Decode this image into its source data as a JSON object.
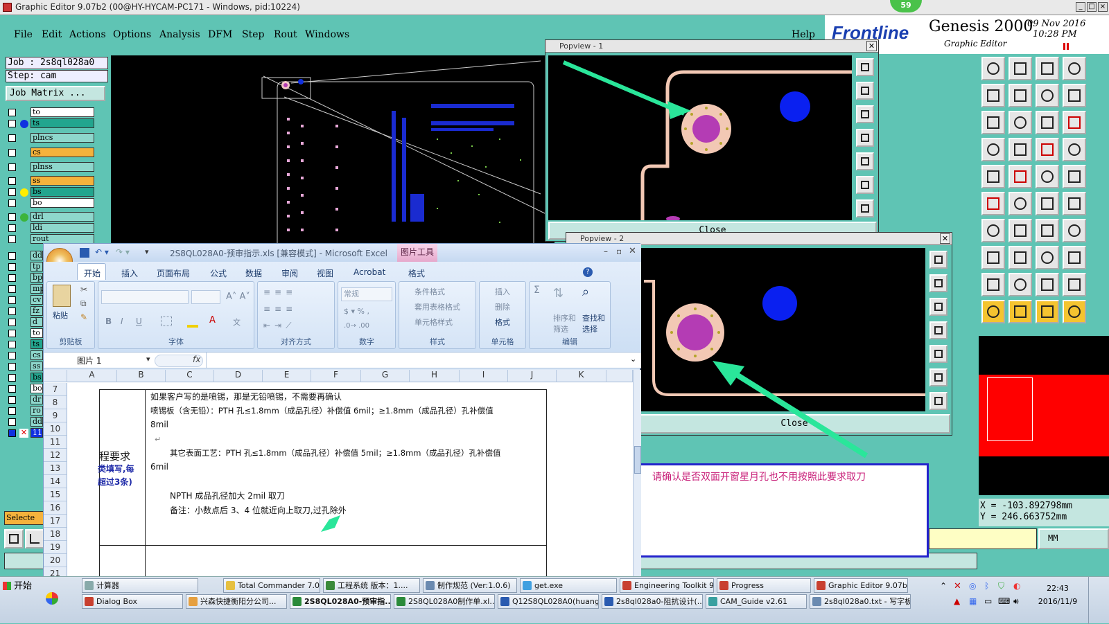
{
  "genesis": {
    "window_title": "Graphic Editor 9.07b2 (00@HY-HYCAM-PC171 - Windows, pid:10224)",
    "menu": [
      "File",
      "Edit",
      "Actions",
      "Options",
      "Analysis",
      "DFM",
      "Step",
      "Rout",
      "Windows"
    ],
    "help": "Help",
    "brand_logo": "Frontline",
    "brand_name": "Genesis 2000",
    "brand_sub": "Graphic Editor",
    "date": "09 Nov 2016",
    "time": "10:28 PM",
    "badge": "59",
    "job_label": "Job : 2s8ql028a0",
    "step_label": "Step: cam",
    "job_matrix": "Job Matrix ...",
    "selected_label": "Selecte",
    "layers": [
      {
        "name": "to",
        "color": "#ffffff",
        "dot": ""
      },
      {
        "name": "ts",
        "color": "#22a58e",
        "dot": "#1030e0"
      },
      {
        "name": "plncs",
        "color": "#8ed7cc",
        "dot": ""
      },
      {
        "name": "cs",
        "color": "#f5b23c",
        "dot": ""
      },
      {
        "name": "plnss",
        "color": "#8ed7cc",
        "dot": ""
      },
      {
        "name": "ss",
        "color": "#f5b23c",
        "dot": ""
      },
      {
        "name": "bs",
        "color": "#22a58e",
        "dot": "#ffee00"
      },
      {
        "name": "bo",
        "color": "#ffffff",
        "dot": ""
      },
      {
        "name": "drl",
        "color": "#8ed7cc",
        "dot": "#3cb43c"
      },
      {
        "name": "ldi",
        "color": "#8ed7cc",
        "dot": ""
      },
      {
        "name": "rout",
        "color": "#8ed7cc",
        "dot": ""
      }
    ],
    "layers_short": [
      "dd",
      "tp",
      "bp",
      "mp",
      "cv",
      "fz",
      "d",
      "to",
      "ts",
      "cs",
      "ss",
      "bs",
      "bo",
      "dr",
      "ro",
      "dd",
      "11"
    ],
    "coords": {
      "x": "X  =  -103.892798mm",
      "y": "Y  =  246.663752mm"
    },
    "units": "MM"
  },
  "popview1": {
    "title": "Popview - 1",
    "close": "Close"
  },
  "popview2": {
    "title": "Popview - 2",
    "close": "Close"
  },
  "note": "请确认是否双面开窗星月孔也不用按照此要求取刀",
  "excel": {
    "title": "2S8QL028A0-预审指示.xls  [兼容模式] - Microsoft Excel",
    "context_tab": "图片工具",
    "tabs": [
      "开始",
      "插入",
      "页面布局",
      "公式",
      "数据",
      "审阅",
      "视图",
      "Acrobat",
      "格式"
    ],
    "groups": {
      "clipboard": {
        "label": "剪贴板",
        "paste": "粘贴"
      },
      "font": {
        "label": "字体"
      },
      "alignment": {
        "label": "对齐方式"
      },
      "number": {
        "label": "数字",
        "format": "常规"
      },
      "styles": {
        "label": "样式",
        "items": [
          "条件格式",
          "套用表格格式",
          "单元格样式"
        ]
      },
      "cells": {
        "label": "单元格",
        "items": [
          "插入",
          "删除",
          "格式"
        ]
      },
      "editing": {
        "label": "编辑",
        "sort": "排序和筛选",
        "find": "查找和选择"
      }
    },
    "name_box": "图片 1",
    "fx": "fx",
    "columns": [
      "A",
      "B",
      "C",
      "D",
      "E",
      "F",
      "G",
      "H",
      "I",
      "J",
      "K"
    ],
    "rows": [
      "7",
      "8",
      "9",
      "10",
      "11",
      "12",
      "13",
      "14",
      "15",
      "16",
      "17",
      "18",
      "19",
      "20",
      "21"
    ],
    "left_labels": [
      "程要求",
      "类填写,每",
      "超过3条)"
    ],
    "lines": [
      "如果客户写的是喷锡，那是无铅喷锡，不需要再确认",
      "喷锡板（含无铅）：PTH 孔≤1.8mm（成品孔径）补偿值 6mil；≥1.8mm（成品孔径）孔补偿值",
      "8mil",
      "其它表面工艺：PTH 孔≤1.8mm（成品孔径）补偿值 5mil；≥1.8mm（成品孔径）孔补偿值",
      "6mil",
      "NPTH 成品孔径加大 2mil 取刀",
      "备注：小数点后 3、4 位就近向上取刀,过孔除外"
    ]
  },
  "taskbar": {
    "start": "开始",
    "row1": [
      "计算器",
      "Total Commander 7.0...",
      "工程系统  版本：1....",
      "制作规范 (Ver:1.0.6)",
      "get.exe",
      "Engineering Toolkit 9....",
      "Progress",
      "Graphic Editor 9.07b..."
    ],
    "row2": [
      "Dialog Box",
      "兴森快捷衡阳分公司...",
      "2S8QL028A0-预审指...",
      "2S8QL028A0制作单.xl...",
      "Q12S8QL028A0(huang...",
      "2s8ql028a0-阻抗设计(...",
      "CAM_Guide v2.61",
      "2s8ql028a0.txt - 写字板"
    ],
    "clock_time": "22:43",
    "clock_date": "2016/11/9"
  }
}
